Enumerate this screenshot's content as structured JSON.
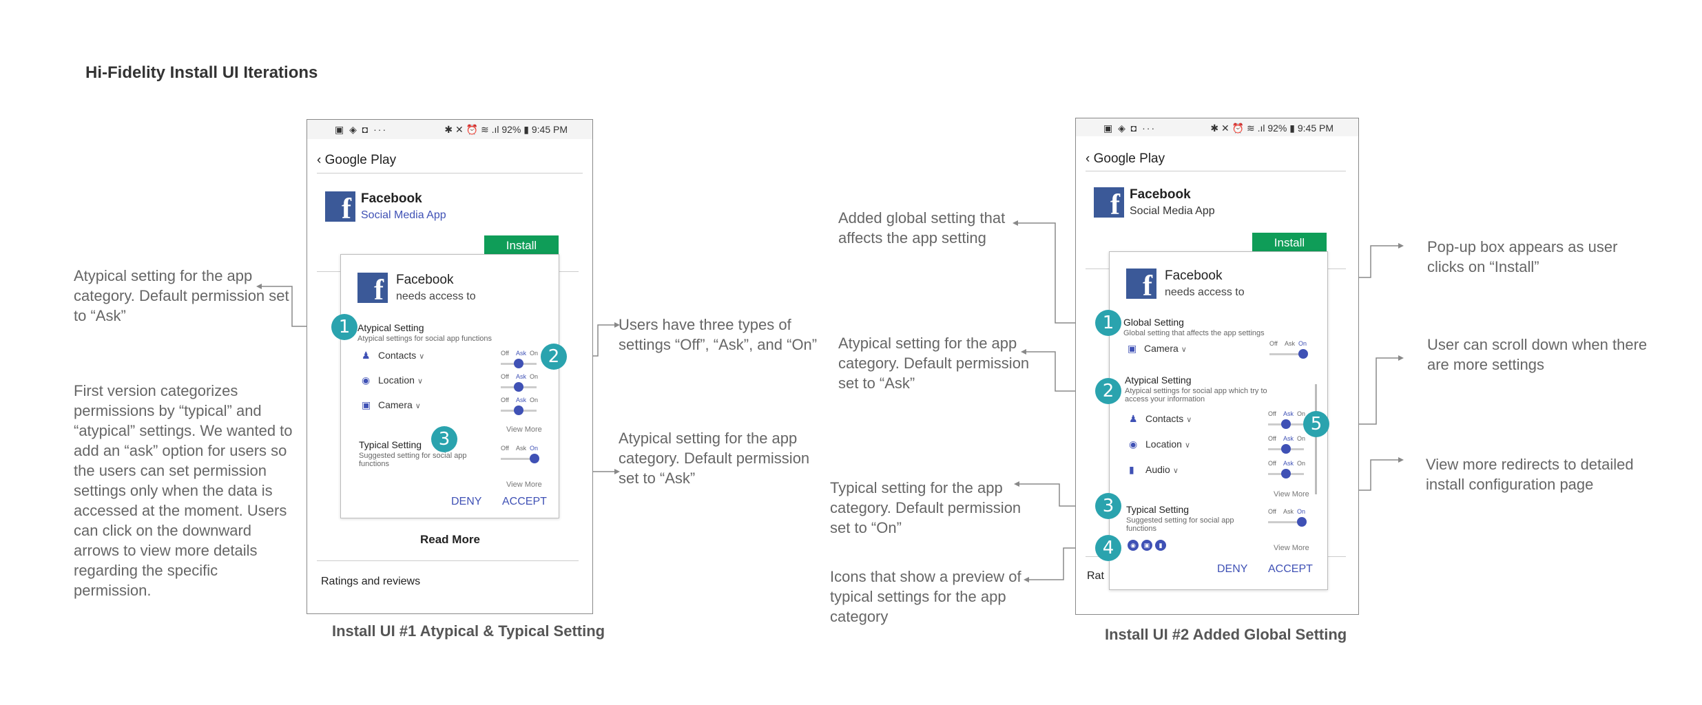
{
  "page_title": "Hi-Fidelity Install UI Iterations",
  "left_notes": {
    "atypical": "Atypical setting for the app category. Default permission set to “Ask”",
    "first_version": "First version categorizes permissions by “typical” and “atypical” settings. We wanted to add an “ask” option for users so the users can set permission settings only when the data is accessed at the moment. Users can click on the downward arrows to view more details regarding the specific permission."
  },
  "status_bar": {
    "left": "▣ ◈ ◘ ···",
    "right": "✱ ✕ ⏰ ≋ .ıl 92% ▮ 9:45 PM"
  },
  "toggle_labels": {
    "off": "Off",
    "ask": "Ask",
    "on": "On"
  },
  "ui1": {
    "store_back_label": "Google Play",
    "app_name": "Facebook",
    "app_category": "Social Media App",
    "install_label": "Install",
    "dialog": {
      "title": "Facebook",
      "subtitle": "needs access to",
      "atypical_title": "Atypical Setting",
      "atypical_desc": "Atypical settings for social app functions",
      "perms": [
        "Contacts",
        "Location",
        "Camera"
      ],
      "typical_title": "Typical Setting",
      "typical_desc": "Suggested setting for social app functions",
      "view_more": "View More",
      "deny": "DENY",
      "accept": "ACCEPT"
    },
    "read_more": "Read More",
    "ratings": "Ratings and reviews",
    "caption": "Install UI #1 Atypical & Typical Setting",
    "notes": {
      "three_types": "Users have three types of settings “Off”, “Ask”, and “On”",
      "atypical_right": "Atypical setting for the app category. Default permission set to “Ask”"
    }
  },
  "ui2": {
    "store_back_label": "Google Play",
    "app_name": "Facebook",
    "app_category": "Social Media App",
    "install_label": "Install",
    "dialog": {
      "title": "Facebook",
      "subtitle": "needs access to",
      "global_title": "Global Setting",
      "global_desc": "Global setting that affects the app settings",
      "global_perm": "Camera",
      "atypical_title": "Atypical Setting",
      "atypical_desc": "Atypical settings for social app which try to access your information",
      "perms": [
        "Contacts",
        "Location",
        "Audio"
      ],
      "typical_title": "Typical Setting",
      "typical_desc": "Suggested setting for social app functions",
      "view_more": "View More",
      "deny": "DENY",
      "accept": "ACCEPT"
    },
    "ratings_partial": "Rat",
    "caption": "Install UI #2 Added Global Setting",
    "notes": {
      "global": "Added global setting that affects the app setting",
      "atypical": "Atypical setting for the app category. Default permission set to “Ask”",
      "typical": "Typical setting for the app category. Default permission set to “On”",
      "icons": "Icons that show a preview of typical settings for the app category",
      "popup": "Pop-up box appears as user clicks on “Install”",
      "scroll": "User can scroll down when there are more settings",
      "view_more": "View more redirects to detailed install configuration page"
    }
  },
  "badges": [
    "1",
    "2",
    "3",
    "4",
    "5"
  ]
}
